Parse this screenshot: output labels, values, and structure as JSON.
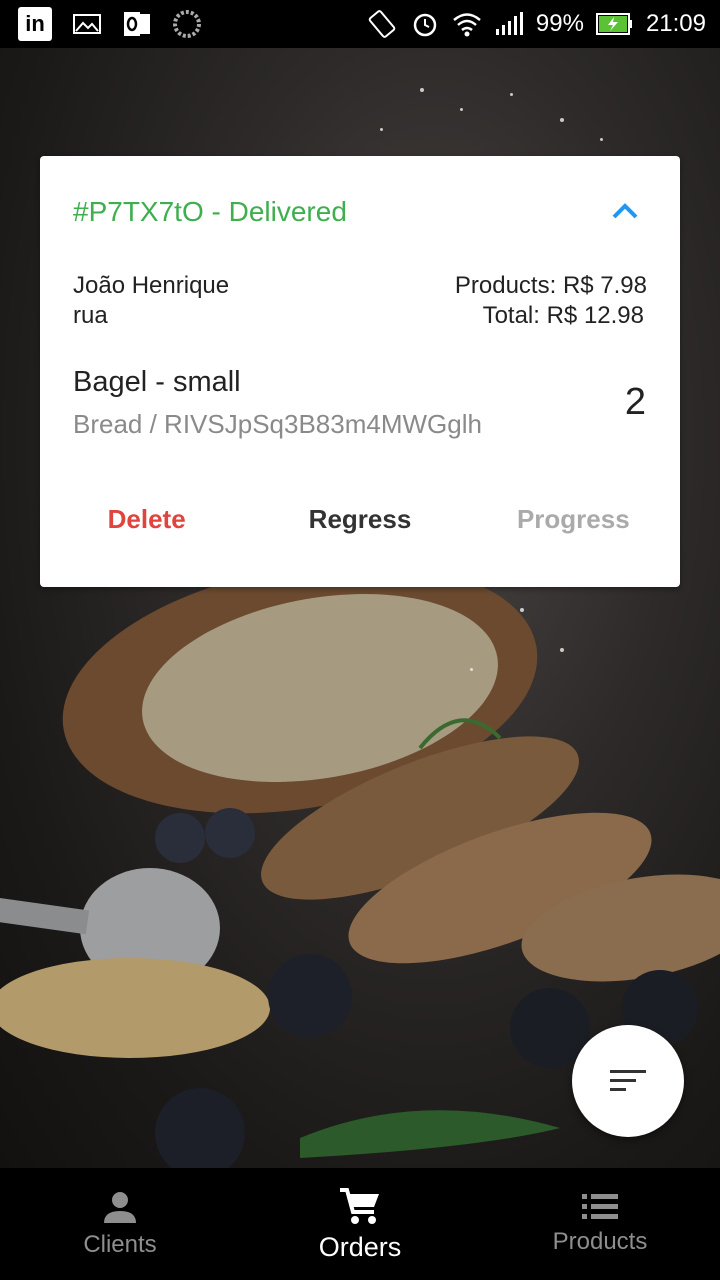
{
  "statusbar": {
    "battery": "99%",
    "time": "21:09"
  },
  "order": {
    "header": "#P7TX7tO - Delivered",
    "client_name": "João Henrique",
    "client_address": "rua",
    "products_total": "Products: R$ 7.98",
    "total": "Total: R$ 12.98",
    "item": {
      "name": "Bagel - small",
      "detail": "Bread / RIVSJpSq3B83m4MWGglh",
      "quantity": "2"
    },
    "actions": {
      "delete": "Delete",
      "regress": "Regress",
      "progress": "Progress"
    }
  },
  "nav": {
    "clients": "Clients",
    "orders": "Orders",
    "products": "Products"
  },
  "colors": {
    "status_delivered": "#3fae4f",
    "delete": "#e0443e",
    "accent": "#2196f3"
  },
  "icons": {
    "fab": "filter-icon",
    "clients": "person-icon",
    "orders": "cart-icon",
    "products": "list-icon"
  }
}
